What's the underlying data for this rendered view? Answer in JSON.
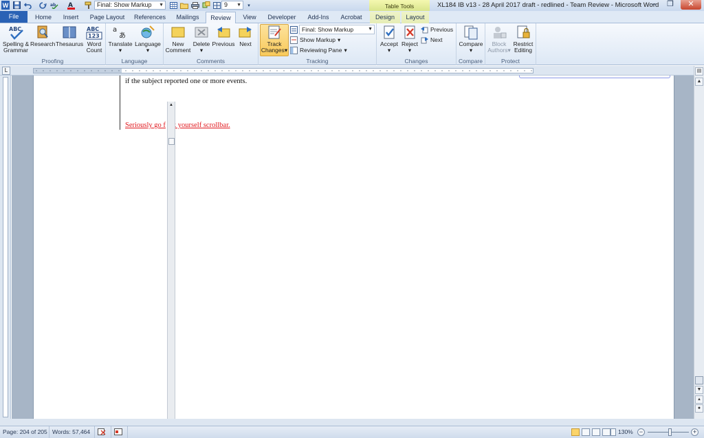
{
  "titlebar": {
    "title": "XL184 IB v13 - 28 April 2017 draft - redlined - Team Review - Microsoft Word",
    "quick_access_markup": "Final: Show Markup",
    "quick_access_font_size": "9",
    "contextual_tab": "Table Tools",
    "minimize": "–",
    "restore": "❐",
    "close": "✕"
  },
  "tabs": [
    "File",
    "Home",
    "Insert",
    "Page Layout",
    "References",
    "Mailings",
    "Review",
    "View",
    "Developer",
    "Add-Ins",
    "Acrobat",
    "Design",
    "Layout"
  ],
  "ribbon": {
    "proofing": {
      "label": "Proofing",
      "spelling": "Spelling &",
      "grammar": "Grammar",
      "research": "Research",
      "thesaurus": "Thesaurus",
      "word": "Word",
      "count": "Count"
    },
    "language": {
      "label": "Language",
      "translate": "Translate",
      "language": "Language"
    },
    "comments": {
      "label": "Comments",
      "new": "New",
      "comment": "Comment",
      "delete": "Delete",
      "previous": "Previous",
      "next": "Next"
    },
    "tracking": {
      "label": "Tracking",
      "track": "Track",
      "changes": "Changes",
      "display_for_review": "Final: Show Markup",
      "show_markup": "Show Markup",
      "reviewing_pane": "Reviewing Pane"
    },
    "changes": {
      "label": "Changes",
      "accept": "Accept",
      "reject": "Reject",
      "previous": "Previous",
      "next": "Next"
    },
    "compare": {
      "label": "Compare",
      "compare": "Compare"
    },
    "protect": {
      "label": "Protect",
      "block": "Block",
      "authors": "Authors",
      "restrict": "Restrict",
      "editing": "Editing"
    }
  },
  "document": {
    "line1": "if the subject reported one or more events.",
    "line2": "Seriously go f",
    "line2_rest": "k yourself scrollbar."
  },
  "status": {
    "page": "Page: 204 of 205",
    "words": "Words: 57,464",
    "zoom": "130%",
    "zoom_minus": "−",
    "zoom_plus": "+"
  },
  "colors": {
    "accent": "#2a62b5",
    "insertion": "#e0171d",
    "ribbon": "#dde8f5"
  }
}
